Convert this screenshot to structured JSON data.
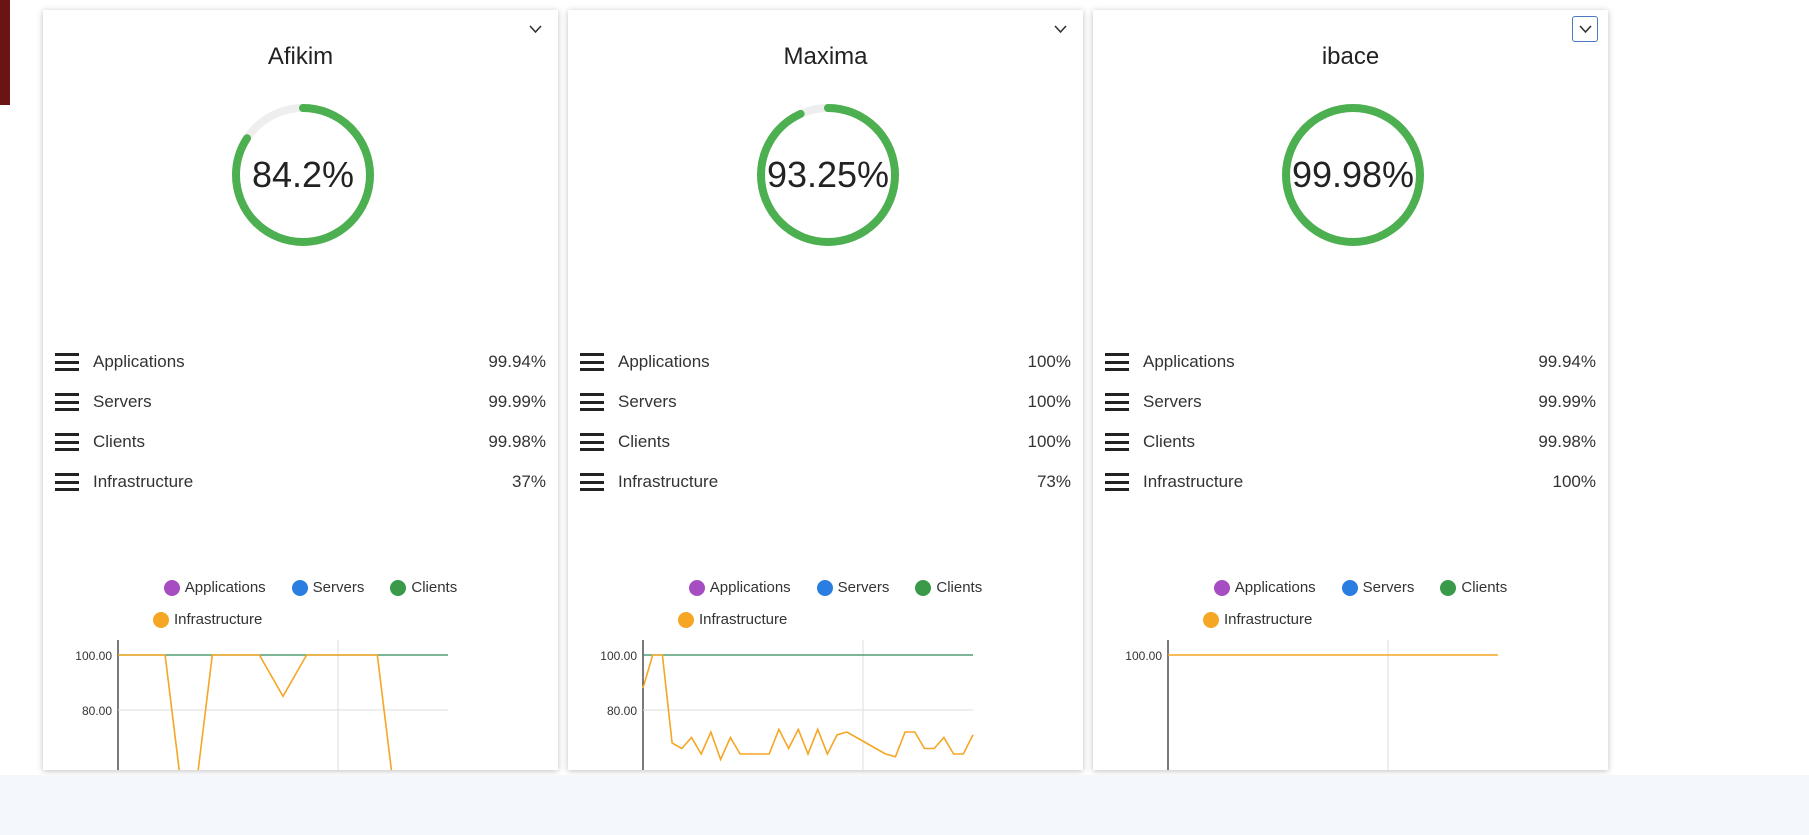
{
  "cards": [
    {
      "title": "Afikim",
      "percent": "84.2%",
      "percent_value": 84.2,
      "categories": [
        {
          "label": "Applications",
          "value": "99.94%"
        },
        {
          "label": "Servers",
          "value": "99.99%"
        },
        {
          "label": "Clients",
          "value": "99.98%"
        },
        {
          "label": "Infrastructure",
          "value": "37%"
        }
      ],
      "legend": [
        "Applications",
        "Servers",
        "Clients",
        "Infrastructure"
      ],
      "y_ticks": [
        "100.00",
        "80.00"
      ],
      "infra_series": [
        100,
        100,
        100,
        30,
        100,
        100,
        100,
        85,
        100,
        100,
        100,
        100,
        30,
        30,
        30
      ]
    },
    {
      "title": "Maxima",
      "percent": "93.25%",
      "percent_value": 93.25,
      "categories": [
        {
          "label": "Applications",
          "value": "100%"
        },
        {
          "label": "Servers",
          "value": "100%"
        },
        {
          "label": "Clients",
          "value": "100%"
        },
        {
          "label": "Infrastructure",
          "value": "73%"
        }
      ],
      "legend": [
        "Applications",
        "Servers",
        "Clients",
        "Infrastructure"
      ],
      "y_ticks": [
        "100.00",
        "80.00"
      ],
      "infra_series": [
        88,
        100,
        100,
        68,
        66,
        70,
        64,
        72,
        62,
        70,
        64,
        64,
        64,
        64,
        73,
        66,
        73,
        64,
        73,
        64,
        71,
        72,
        70,
        68,
        66,
        64,
        63,
        72,
        72,
        66,
        66,
        70,
        64,
        64,
        71
      ]
    },
    {
      "title": "ibace",
      "percent": "99.98%",
      "percent_value": 99.98,
      "categories": [
        {
          "label": "Applications",
          "value": "99.94%"
        },
        {
          "label": "Servers",
          "value": "99.99%"
        },
        {
          "label": "Clients",
          "value": "99.98%"
        },
        {
          "label": "Infrastructure",
          "value": "100%"
        }
      ],
      "legend": [
        "Applications",
        "Servers",
        "Clients",
        "Infrastructure"
      ],
      "y_ticks": [
        "100.00"
      ],
      "infra_series": [
        100,
        100
      ]
    }
  ],
  "colors": {
    "gauge": "#4caf50",
    "gauge_track": "#eeeeee",
    "applications": "#a64dc1",
    "servers": "#2a7de1",
    "clients": "#3a9a4a",
    "infrastructure": "#f5a623",
    "clients_line": "#2e8b57"
  },
  "icons": {
    "collapse": "chevron-down-icon",
    "category": "hamburger-icon"
  }
}
